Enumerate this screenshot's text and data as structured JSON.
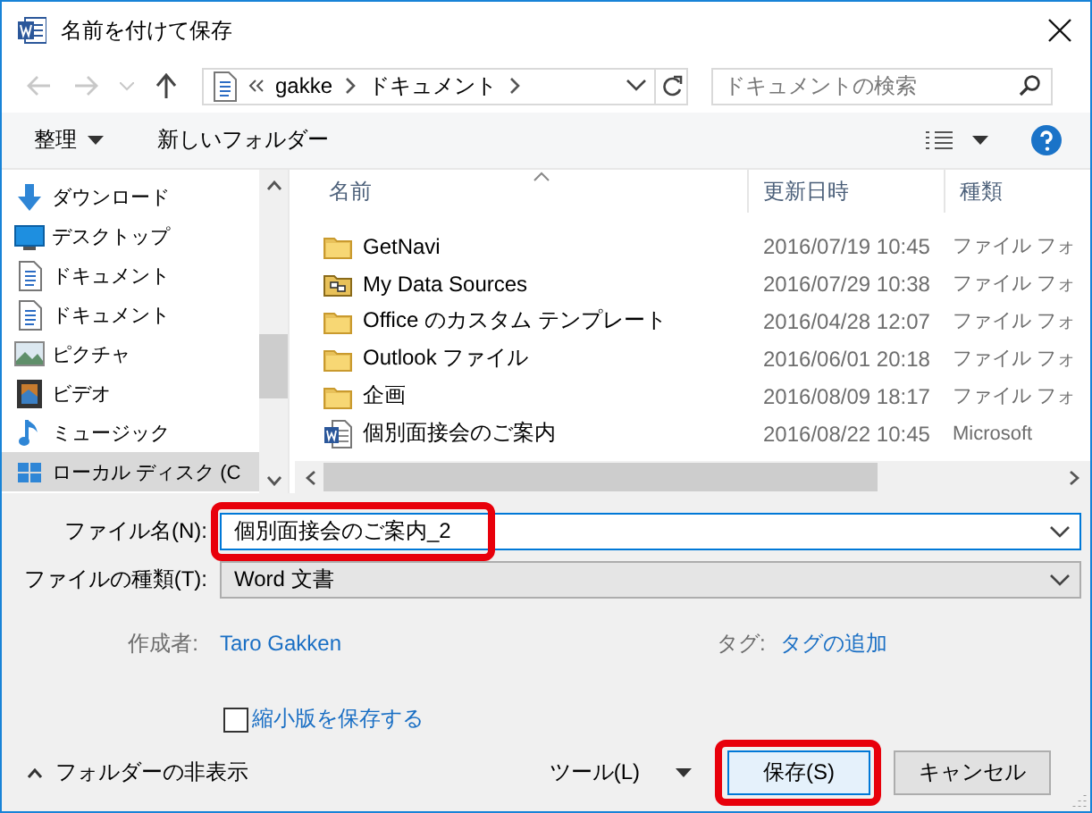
{
  "window": {
    "title": "名前を付けて保存"
  },
  "address_bar": {
    "segments": [
      "gakke",
      "ドキュメント"
    ]
  },
  "search": {
    "placeholder": "ドキュメントの検索"
  },
  "toolbar": {
    "organize": "整理",
    "new_folder": "新しいフォルダー"
  },
  "sidebar": {
    "items": [
      {
        "label": "ダウンロード",
        "kind": "download",
        "selected": false
      },
      {
        "label": "デスクトップ",
        "kind": "desktop",
        "selected": false
      },
      {
        "label": "ドキュメント",
        "kind": "document",
        "selected": false
      },
      {
        "label": "ドキュメント",
        "kind": "document",
        "selected": false
      },
      {
        "label": "ピクチャ",
        "kind": "picture",
        "selected": false
      },
      {
        "label": "ビデオ",
        "kind": "video",
        "selected": false
      },
      {
        "label": "ミュージック",
        "kind": "music",
        "selected": false
      },
      {
        "label": "ローカル ディスク (C",
        "kind": "drive",
        "selected": true
      }
    ]
  },
  "file_list": {
    "columns": [
      "名前",
      "更新日時",
      "種類"
    ],
    "rows": [
      {
        "name": "GetNavi",
        "modified": "2016/07/19 10:45",
        "type": "ファイル フォ",
        "kind": "folder"
      },
      {
        "name": "My Data Sources",
        "modified": "2016/07/29 10:38",
        "type": "ファイル フォ",
        "kind": "datasource"
      },
      {
        "name": "Office のカスタム テンプレート",
        "modified": "2016/04/28 12:07",
        "type": "ファイル フォ",
        "kind": "folder"
      },
      {
        "name": "Outlook ファイル",
        "modified": "2016/06/01 20:18",
        "type": "ファイル フォ",
        "kind": "folder"
      },
      {
        "name": "企画",
        "modified": "2016/08/09 18:17",
        "type": "ファイル フォ",
        "kind": "folder"
      },
      {
        "name": "個別面接会のご案内",
        "modified": "2016/08/22 10:45",
        "type": "Microsoft",
        "kind": "word"
      }
    ]
  },
  "form": {
    "file_name": {
      "label": "ファイル名(N):",
      "value": "個別面接会のご案内_2",
      "highlighted": true
    },
    "file_type": {
      "label": "ファイルの種類(T):",
      "value": "Word 文書"
    },
    "author": {
      "label": "作成者:",
      "value": "Taro Gakken"
    },
    "tags": {
      "label": "タグ:",
      "value": "タグの追加"
    },
    "thumbnail": {
      "label": "縮小版を保存する",
      "checked": false
    }
  },
  "footer": {
    "hide_folders": "フォルダーの非表示",
    "tools": "ツール(L)",
    "save": {
      "label": "保存(S)",
      "highlighted": true
    },
    "cancel": "キャンセル"
  }
}
